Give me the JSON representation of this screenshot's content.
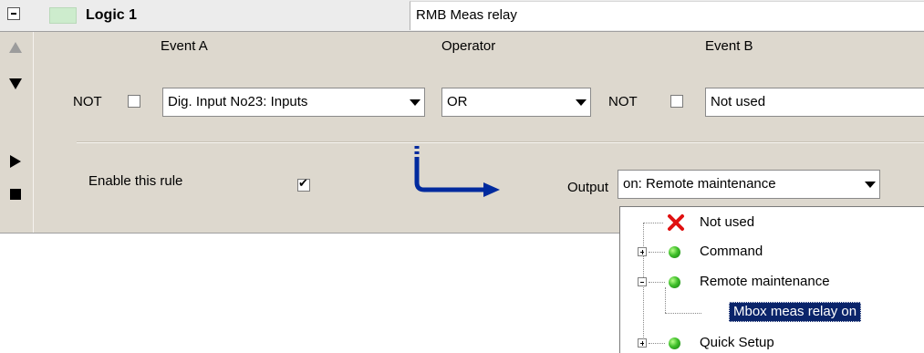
{
  "header": {
    "title": "Logic 1",
    "description": "RMB Meas relay",
    "swatch_color": "#cdeccd"
  },
  "rule": {
    "event_a_label": "Event A",
    "operator_label": "Operator",
    "event_b_label": "Event B",
    "not_label": "NOT",
    "not_b_label": "NOT",
    "event_a_value": "Dig. Input No23: Inputs",
    "operator_value": "OR",
    "event_b_value": "Not used",
    "enable_label": "Enable this rule",
    "enable_checked": true,
    "output_label": "Output",
    "output_value": "on: Remote maintenance"
  },
  "tree": {
    "items": [
      {
        "label": "Not used",
        "icon": "red-x-icon"
      },
      {
        "label": "Command",
        "icon": "green-ball-icon",
        "expander": "plus"
      },
      {
        "label": "Remote maintenance",
        "icon": "green-ball-icon",
        "expander": "minus"
      },
      {
        "label": "Mbox meas relay on",
        "selected": true
      },
      {
        "label": "Quick Setup",
        "icon": "green-ball-icon",
        "expander": "plus"
      }
    ]
  },
  "colors": {
    "panel_bg": "#ddd8ce",
    "arrow_blue": "#002a9e",
    "selection_bg": "#0a246a"
  }
}
